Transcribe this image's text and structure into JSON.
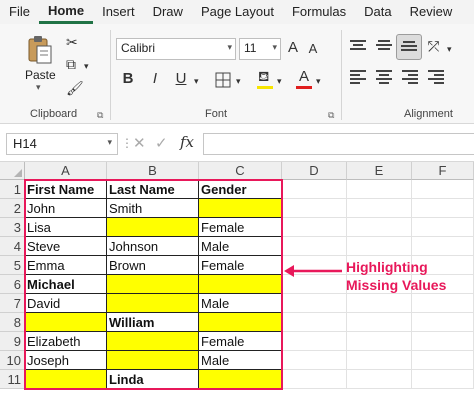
{
  "menu": [
    "File",
    "Home",
    "Insert",
    "Draw",
    "Page Layout",
    "Formulas",
    "Data",
    "Review"
  ],
  "ribbon": {
    "clipboard": {
      "paste_label": "Paste",
      "group_label": "Clipboard"
    },
    "font": {
      "font_name": "Calibri",
      "font_size": "11",
      "bold": "B",
      "italic": "I",
      "underline": "U",
      "grow": "A",
      "shrink": "A",
      "font_color": "A",
      "group_label": "Font"
    },
    "alignment": {
      "group_label": "Alignment"
    }
  },
  "formula_bar": {
    "name_box": "H14",
    "fx": "fx",
    "cancel": "✕",
    "enter": "✓",
    "formula": ""
  },
  "columns": [
    "A",
    "B",
    "C",
    "D",
    "E",
    "F"
  ],
  "rows": [
    "1",
    "2",
    "3",
    "4",
    "5",
    "6",
    "7",
    "8",
    "9",
    "10",
    "11"
  ],
  "table": {
    "headers": [
      "First Name",
      "Last Name",
      "Gender"
    ],
    "data": [
      [
        "John",
        "Smith",
        ""
      ],
      [
        "Lisa",
        "",
        "Female"
      ],
      [
        "Steve",
        "Johnson",
        "Male"
      ],
      [
        "Emma",
        "Brown",
        "Female"
      ],
      [
        "Michael",
        "",
        ""
      ],
      [
        "David",
        "",
        "Male"
      ],
      [
        "",
        "William",
        ""
      ],
      [
        "Elizabeth",
        "",
        "Female"
      ],
      [
        "Joseph",
        "",
        "Male"
      ],
      [
        "",
        "Linda",
        ""
      ]
    ]
  },
  "annotation": {
    "line1": "Highlighting",
    "line2": "Missing Values"
  },
  "colors": {
    "highlight": "#ffff00",
    "accent": "#e8185a",
    "excel_green": "#217346"
  }
}
